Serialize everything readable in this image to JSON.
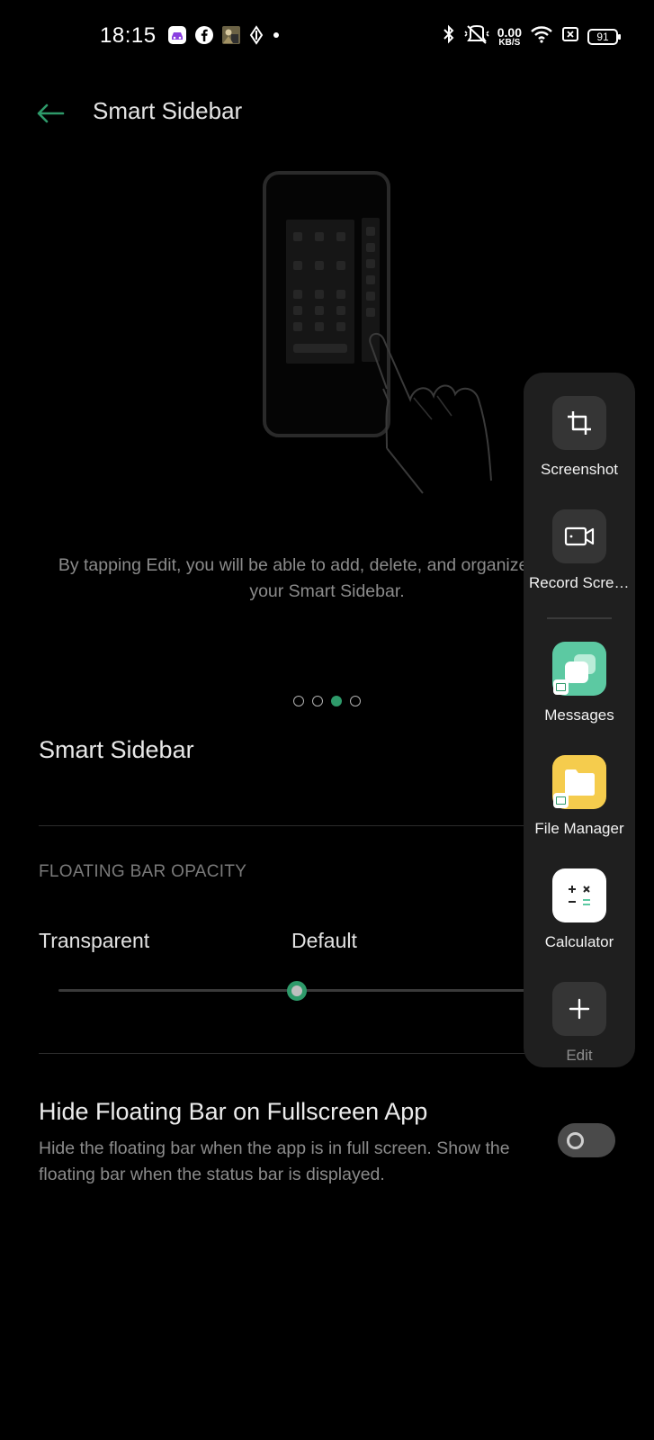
{
  "status_bar": {
    "time": "18:15",
    "net_speed_value": "0.00",
    "net_speed_unit": "KB/S",
    "battery": "91",
    "icons": [
      "app-notification-icon",
      "facebook-icon",
      "photo-notification-icon",
      "location-icon",
      "dot-icon",
      "bluetooth-icon",
      "vibrate-off-icon",
      "wifi-icon",
      "sim-icon",
      "battery-icon"
    ]
  },
  "header": {
    "title": "Smart Sidebar"
  },
  "tutorial": {
    "description": "By tapping Edit, you will be able to add, delete, and organize apps on your Smart Sidebar.",
    "page_count": 4,
    "active_page": 3
  },
  "settings": {
    "smart_sidebar_label": "Smart Sidebar",
    "opacity_section": "FLOATING BAR OPACITY",
    "opacity_min_label": "Transparent",
    "opacity_default_label": "Default",
    "opacity_value_fraction": 0.5,
    "hide_title": "Hide Floating Bar on Fullscreen App",
    "hide_desc": "Hide the floating bar when the app is in full screen. Show the floating bar when the status bar is displayed.",
    "hide_enabled": false
  },
  "sidebar": {
    "items": [
      {
        "label": "Screenshot",
        "icon": "crop-icon"
      },
      {
        "label": "Record Screen",
        "icon": "video-record-icon"
      },
      {
        "label": "Messages",
        "icon": "messages-icon"
      },
      {
        "label": "File Manager",
        "icon": "folder-icon"
      },
      {
        "label": "Calculator",
        "icon": "calculator-icon"
      },
      {
        "label": "Edit",
        "icon": "plus-icon"
      }
    ]
  },
  "colors": {
    "accent": "#2e9a6a",
    "background": "#000000",
    "panel": "#1f1f1f"
  }
}
